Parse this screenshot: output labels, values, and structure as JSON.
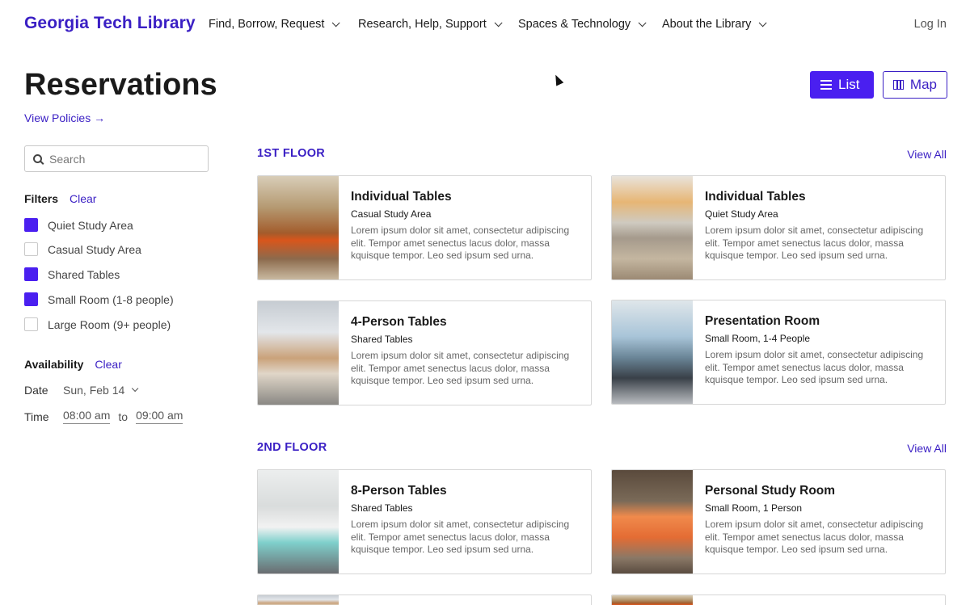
{
  "header": {
    "brand": "Georgia Tech Library",
    "nav": [
      {
        "label": "Find, Borrow, Request"
      },
      {
        "label": "Research, Help, Support"
      },
      {
        "label": "Spaces & Technology"
      },
      {
        "label": "About the Library"
      }
    ],
    "login": "Log In"
  },
  "page": {
    "title": "Reservations",
    "policies_link": "View Policies →",
    "view_list": "List",
    "view_map": "Map"
  },
  "sidebar": {
    "search_placeholder": "Search",
    "filters_label": "Filters",
    "filters_clear": "Clear",
    "filters": [
      {
        "label": "Quiet Study Area",
        "checked": true
      },
      {
        "label": "Casual Study Area",
        "checked": false
      },
      {
        "label": "Shared Tables",
        "checked": true
      },
      {
        "label": "Small Room (1-8 people)",
        "checked": true
      },
      {
        "label": "Large Room (9+ people)",
        "checked": false
      }
    ],
    "availability_label": "Availability",
    "availability_clear": "Clear",
    "date_label": "Date",
    "date_value": "Sun, Feb 14",
    "time_label": "Time",
    "time_from": "08:00 am",
    "time_sep": "to",
    "time_to": "09:00 am"
  },
  "floors": [
    {
      "name": "1ST FLOOR",
      "view_all": "View All",
      "cards": [
        {
          "title": "Individual Tables",
          "subtitle": "Casual Study Area",
          "desc": "Lorem ipsum dolor sit amet, consectetur adipiscing elit. Tempor amet senectus lacus dolor, massa kquisque tempor. Leo sed ipsum sed urna."
        },
        {
          "title": "Individual Tables",
          "subtitle": "Quiet Study Area",
          "desc": "Lorem ipsum dolor sit amet, consectetur adipiscing elit. Tempor amet senectus lacus dolor, massa kquisque tempor. Leo sed ipsum sed urna."
        },
        {
          "title": "4-Person Tables",
          "subtitle": "Shared Tables",
          "desc": "Lorem ipsum dolor sit amet, consectetur adipiscing elit. Tempor amet senectus lacus dolor, massa kquisque tempor. Leo sed ipsum sed urna."
        },
        {
          "title": "Presentation Room",
          "subtitle": "Small Room, 1-4 People",
          "desc": "Lorem ipsum dolor sit amet, consectetur adipiscing elit. Tempor amet senectus lacus dolor, massa kquisque tempor. Leo sed ipsum sed urna."
        }
      ]
    },
    {
      "name": "2ND FLOOR",
      "view_all": "View All",
      "cards": [
        {
          "title": "8-Person Tables",
          "subtitle": "Shared Tables",
          "desc": "Lorem ipsum dolor sit amet, consectetur adipiscing elit. Tempor amet senectus lacus dolor, massa kquisque tempor. Leo sed ipsum sed urna."
        },
        {
          "title": "Personal Study Room",
          "subtitle": "Small Room, 1 Person",
          "desc": "Lorem ipsum dolor sit amet, consectetur adipiscing elit. Tempor amet senectus lacus dolor, massa kquisque tempor. Leo sed ipsum sed urna."
        }
      ]
    }
  ],
  "colors": {
    "brand": "#3a1fc4",
    "accent": "#4a1ff0"
  }
}
